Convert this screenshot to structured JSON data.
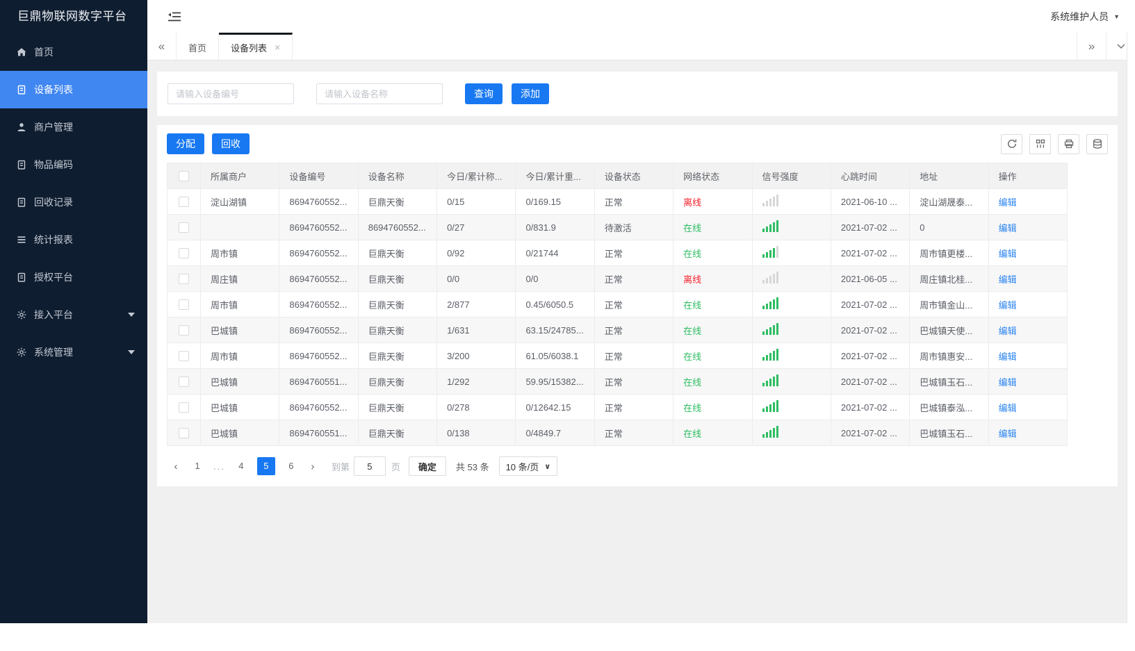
{
  "app": {
    "title": "巨鼎物联网数字平台",
    "user_name": "系统维护人员"
  },
  "sidebar": {
    "items": [
      {
        "label": "首页",
        "icon": "home-icon"
      },
      {
        "label": "设备列表",
        "icon": "doc-icon",
        "active": true
      },
      {
        "label": "商户管理",
        "icon": "user-icon"
      },
      {
        "label": "物品编码",
        "icon": "doc-icon"
      },
      {
        "label": "回收记录",
        "icon": "doc-icon"
      },
      {
        "label": "统计报表",
        "icon": "list-icon"
      },
      {
        "label": "授权平台",
        "icon": "doc-icon"
      },
      {
        "label": "接入平台",
        "icon": "gear-icon",
        "expandable": true
      },
      {
        "label": "系统管理",
        "icon": "gear-icon",
        "expandable": true
      }
    ]
  },
  "tabs": {
    "items": [
      {
        "label": "首页"
      },
      {
        "label": "设备列表",
        "active": true,
        "closable": true
      }
    ]
  },
  "search": {
    "device_no_placeholder": "请输入设备编号",
    "device_name_placeholder": "请输入设备名称",
    "query_label": "查询",
    "add_label": "添加"
  },
  "toolbar": {
    "assign_label": "分配",
    "recycle_label": "回收",
    "icons": [
      {
        "name": "refresh-icon"
      },
      {
        "name": "columns-icon"
      },
      {
        "name": "print-icon"
      },
      {
        "name": "export-icon"
      }
    ]
  },
  "table": {
    "columns": [
      {
        "label": ""
      },
      {
        "label": "所属商户"
      },
      {
        "label": "设备编号"
      },
      {
        "label": "设备名称"
      },
      {
        "label": "今日/累计称..."
      },
      {
        "label": "今日/累计重..."
      },
      {
        "label": "设备状态"
      },
      {
        "label": "网络状态"
      },
      {
        "label": "信号强度"
      },
      {
        "label": "心跳时间"
      },
      {
        "label": "地址"
      },
      {
        "label": "操作"
      }
    ],
    "rows": [
      {
        "merchant": "淀山湖镇",
        "device_no": "8694760552...",
        "device_name": "巨鼎天衡",
        "count": "0/15",
        "weight": "0/169.15",
        "device_status": "正常",
        "network_status": "离线",
        "network_online": false,
        "signal": 0,
        "heartbeat": "2021-06-10 ...",
        "address": "淀山湖晟泰...",
        "action": "编辑"
      },
      {
        "merchant": "",
        "device_no": "8694760552...",
        "device_name": "8694760552...",
        "count": "0/27",
        "weight": "0/831.9",
        "device_status": "待激活",
        "network_status": "在线",
        "network_online": true,
        "signal": 5,
        "heartbeat": "2021-07-02 ...",
        "address": "0",
        "action": "编辑"
      },
      {
        "merchant": "周市镇",
        "device_no": "8694760552...",
        "device_name": "巨鼎天衡",
        "count": "0/92",
        "weight": "0/21744",
        "device_status": "正常",
        "network_status": "在线",
        "network_online": true,
        "signal": 4,
        "heartbeat": "2021-07-02 ...",
        "address": "周市镇更楼...",
        "action": "编辑"
      },
      {
        "merchant": "周庄镇",
        "device_no": "8694760552...",
        "device_name": "巨鼎天衡",
        "count": "0/0",
        "weight": "0/0",
        "device_status": "正常",
        "network_status": "离线",
        "network_online": false,
        "signal": 0,
        "heartbeat": "2021-06-05 ...",
        "address": "周庄镇北桂...",
        "action": "编辑"
      },
      {
        "merchant": "周市镇",
        "device_no": "8694760552...",
        "device_name": "巨鼎天衡",
        "count": "2/877",
        "weight": "0.45/6050.5",
        "device_status": "正常",
        "network_status": "在线",
        "network_online": true,
        "signal": 5,
        "heartbeat": "2021-07-02 ...",
        "address": "周市镇金山...",
        "action": "编辑"
      },
      {
        "merchant": "巴城镇",
        "device_no": "8694760552...",
        "device_name": "巨鼎天衡",
        "count": "1/631",
        "weight": "63.15/24785...",
        "device_status": "正常",
        "network_status": "在线",
        "network_online": true,
        "signal": 5,
        "heartbeat": "2021-07-02 ...",
        "address": "巴城镇天使...",
        "action": "编辑"
      },
      {
        "merchant": "周市镇",
        "device_no": "8694760552...",
        "device_name": "巨鼎天衡",
        "count": "3/200",
        "weight": "61.05/6038.1",
        "device_status": "正常",
        "network_status": "在线",
        "network_online": true,
        "signal": 5,
        "heartbeat": "2021-07-02 ...",
        "address": "周市镇惠安...",
        "action": "编辑"
      },
      {
        "merchant": "巴城镇",
        "device_no": "8694760551...",
        "device_name": "巨鼎天衡",
        "count": "1/292",
        "weight": "59.95/15382...",
        "device_status": "正常",
        "network_status": "在线",
        "network_online": true,
        "signal": 5,
        "heartbeat": "2021-07-02 ...",
        "address": "巴城镇玉石...",
        "action": "编辑"
      },
      {
        "merchant": "巴城镇",
        "device_no": "8694760552...",
        "device_name": "巨鼎天衡",
        "count": "0/278",
        "weight": "0/12642.15",
        "device_status": "正常",
        "network_status": "在线",
        "network_online": true,
        "signal": 5,
        "heartbeat": "2021-07-02 ...",
        "address": "巴城镇泰泓...",
        "action": "编辑"
      },
      {
        "merchant": "巴城镇",
        "device_no": "8694760551...",
        "device_name": "巨鼎天衡",
        "count": "0/138",
        "weight": "0/4849.7",
        "device_status": "正常",
        "network_status": "在线",
        "network_online": true,
        "signal": 5,
        "heartbeat": "2021-07-02 ...",
        "address": "巴城镇玉石...",
        "action": "编辑"
      }
    ]
  },
  "pagination": {
    "pages": [
      "1",
      "...",
      "4",
      "5",
      "6"
    ],
    "active_page": "5",
    "jump_prefix": "到第",
    "jump_value": "5",
    "jump_suffix": "页",
    "confirm_label": "确定",
    "total_label": "共 53 条",
    "page_size": "10 条/页"
  },
  "colors": {
    "primary": "#1778f2",
    "sidebar_bg": "#0f1d30",
    "sidebar_active": "#4187f2",
    "online": "#2ebd62",
    "offline": "#f5222d",
    "link": "#2b85f0"
  }
}
